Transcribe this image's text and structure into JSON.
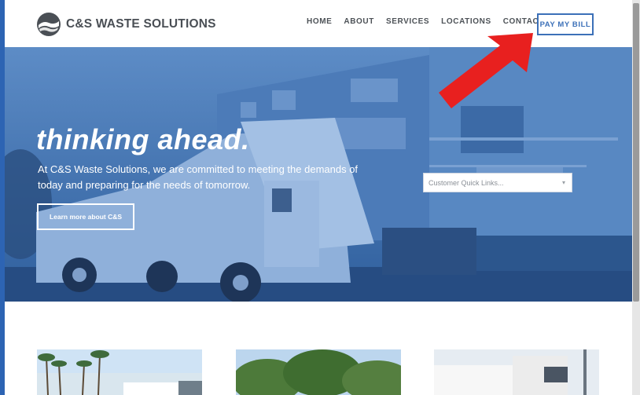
{
  "brand": {
    "name": "C&S WASTE SOLUTIONS",
    "logo_icon": "mountain-waves-icon",
    "accent_color": "#2d64b3"
  },
  "nav": {
    "items": [
      {
        "label": "HOME"
      },
      {
        "label": "ABOUT"
      },
      {
        "label": "SERVICES"
      },
      {
        "label": "LOCATIONS"
      },
      {
        "label": "CONTACT"
      }
    ],
    "pay_label": "PAY MY BILL"
  },
  "hero": {
    "title": "thinking ahead.",
    "body": "At C&S Waste Solutions, we are committed to meeting the demands of today and preparing for the needs of tomorrow.",
    "cta_label": "Learn more about C&S",
    "quick_links_placeholder": "Customer Quick Links...",
    "quick_links_icon": "chevron-down-icon"
  },
  "annotation": {
    "arrow_color": "#e8201f"
  },
  "cards": [
    {
      "image": "palm-trees-truck-photo"
    },
    {
      "image": "trees-photo"
    },
    {
      "image": "garbage-truck-photo"
    }
  ]
}
